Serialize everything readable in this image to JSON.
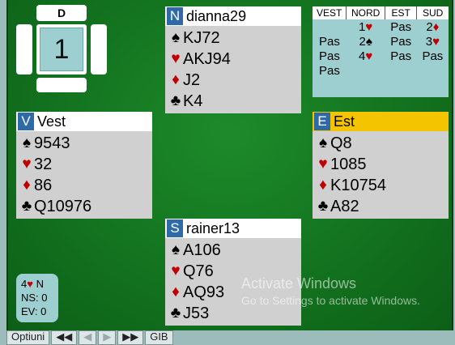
{
  "compass": {
    "dealer": "D",
    "board_number": "1"
  },
  "north": {
    "seat": "N",
    "name": "dianna29",
    "spades": "KJ72",
    "hearts": "AKJ94",
    "diamonds": "J2",
    "clubs": "K4"
  },
  "west": {
    "seat": "V",
    "name": "Vest",
    "spades": "9543",
    "hearts": "32",
    "diamonds": "86",
    "clubs": "Q10976"
  },
  "east": {
    "seat": "E",
    "name": "Est",
    "spades": "Q8",
    "hearts": "1085",
    "diamonds": "K10754",
    "clubs": "A82"
  },
  "south": {
    "seat": "S",
    "name": "rainer13",
    "spades": "A106",
    "hearts": "Q76",
    "diamonds": "AQ93",
    "clubs": "J53"
  },
  "auction": {
    "headers": [
      "VEST",
      "NORD",
      "EST",
      "SUD"
    ],
    "rows": [
      [
        "",
        "1♥",
        "Pas",
        "2♦"
      ],
      [
        "Pas",
        "2♠",
        "Pas",
        "3♥"
      ],
      [
        "Pas",
        "4♥",
        "Pas",
        "Pas"
      ],
      [
        "Pas",
        "",
        "",
        ""
      ]
    ]
  },
  "result": {
    "contract": "4♥ N",
    "ns": "NS: 0",
    "ev": "EV: 0"
  },
  "toolbar": {
    "options": "Optiuni",
    "first": "◀◀",
    "prev": "◀",
    "next": "▶",
    "last": "▶▶",
    "gib": "GIB"
  },
  "watermark": {
    "line1": "Activate Windows",
    "line2": "Go to Settings to activate Windows."
  },
  "suits": {
    "spade": "♠",
    "heart": "♥",
    "diamond": "♦",
    "club": "♣"
  },
  "colors": {
    "felt": "#13731f",
    "active_seat": "#f5c400",
    "seat_badge": "#2f6aa8",
    "red_suit": "#c00000"
  }
}
